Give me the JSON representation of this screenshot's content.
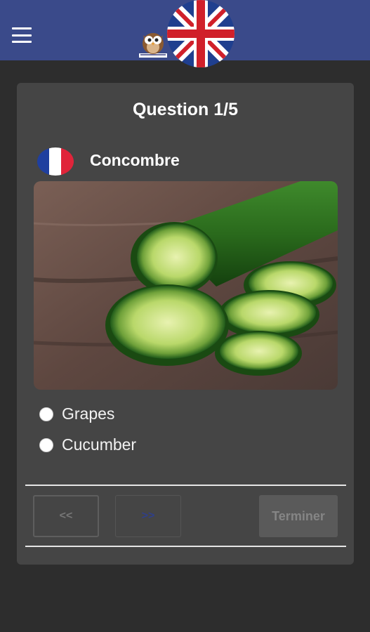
{
  "appbar": {
    "menu_icon": "hamburger-menu-icon",
    "logo_icon": "owl-logo-icon",
    "language_flag": "uk-flag-icon",
    "color": "#3a4a8a"
  },
  "quiz": {
    "title": "Question 1/5",
    "source_flag": "france-flag-icon",
    "word": "Concombre",
    "image": "cucumber-photo",
    "options": [
      {
        "label": "Grapes",
        "selected": false
      },
      {
        "label": "Cucumber",
        "selected": false
      }
    ]
  },
  "navigation": {
    "prev_label": "<<",
    "next_label": ">>",
    "finish_label": "Terminer"
  }
}
